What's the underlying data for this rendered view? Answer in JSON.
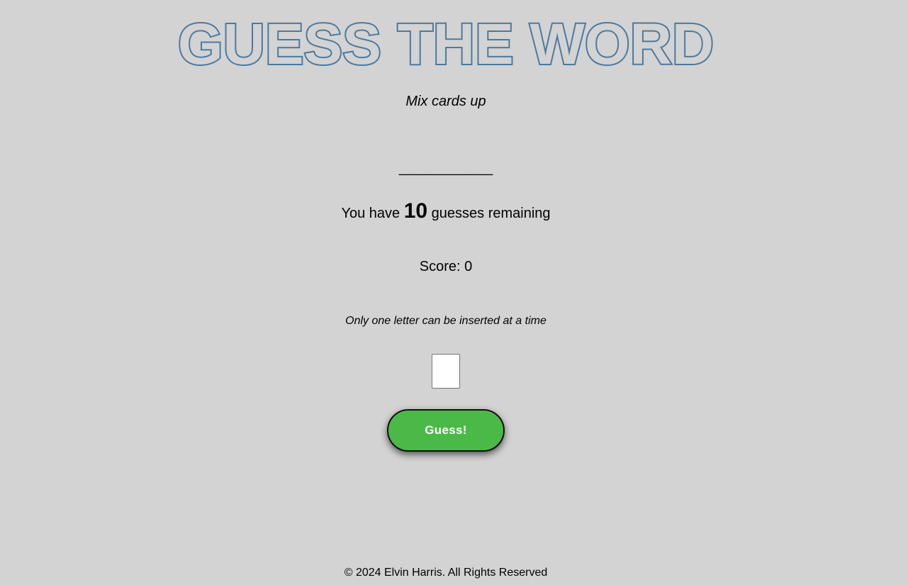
{
  "header": {
    "title": "GUESS THE WORD",
    "shuffle_label": "Mix cards up"
  },
  "game": {
    "word_display": "_______",
    "remaining_prefix": "You have",
    "remaining_count": "10",
    "remaining_suffix": "guesses remaining",
    "score_text": "Score: 0",
    "hint_text": "Only one letter can be inserted at a time",
    "letter_input_value": "",
    "guess_button_label": "Guess!"
  },
  "footer": {
    "text": "© 2024 Elvin Harris. All Rights Reserved"
  },
  "colors": {
    "background": "#d3d3d3",
    "title_outline": "#4a7aa0",
    "button_green": "#4bb948"
  }
}
